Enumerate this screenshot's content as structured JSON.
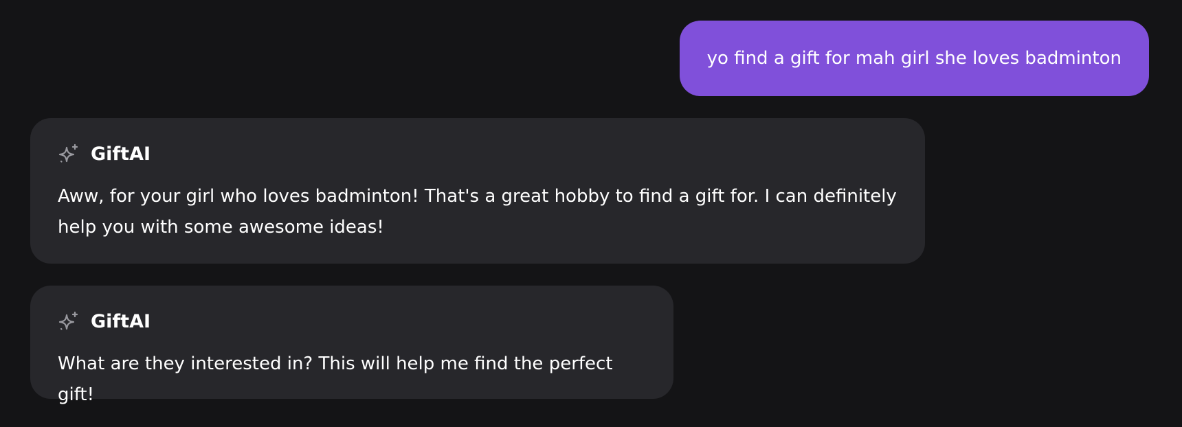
{
  "messages": [
    {
      "role": "user",
      "text": "yo find a gift for mah girl she loves badminton"
    },
    {
      "role": "assistant",
      "name": "GiftAI",
      "icon": "sparkle-icon",
      "text": "Aww, for your girl who loves badminton! That's a great hobby to find a gift for. I can definitely help you with some awesome ideas!"
    },
    {
      "role": "assistant",
      "name": "GiftAI",
      "icon": "sparkle-icon",
      "text": "What are they interested in? This will help me find the perfect gift!"
    }
  ],
  "colors": {
    "background": "#141416",
    "user_bubble": "#8050da",
    "assistant_bubble": "#27272b",
    "text": "#ffffff",
    "icon": "#9a9aa0"
  }
}
